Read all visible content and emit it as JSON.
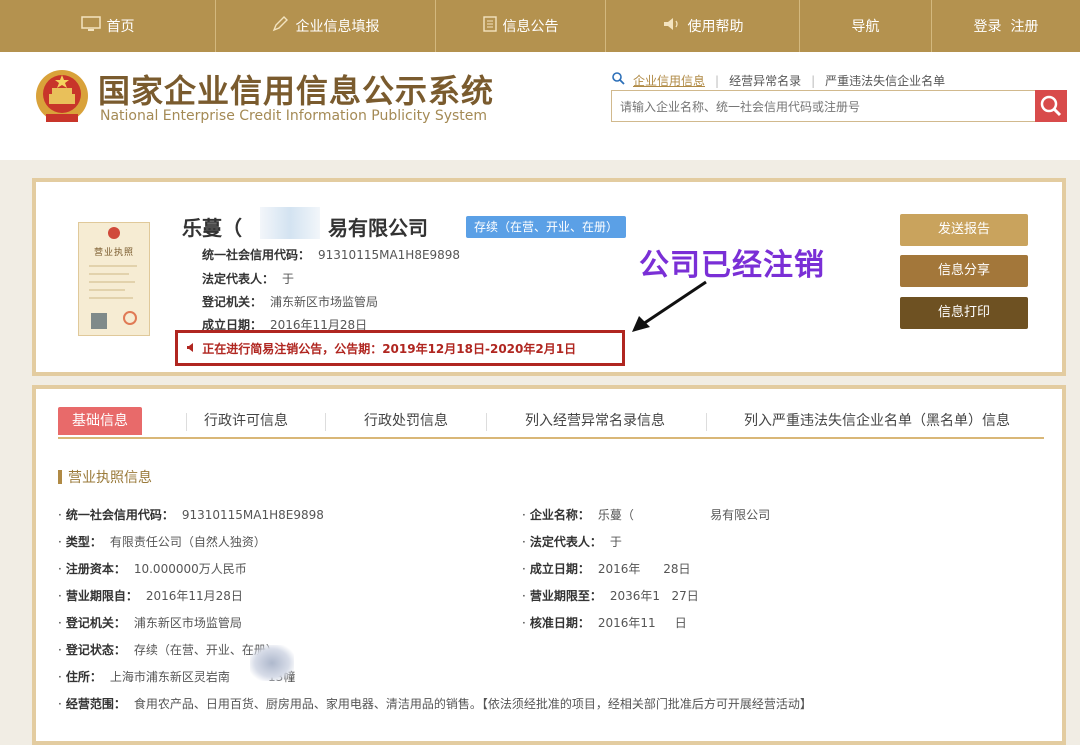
{
  "nav": {
    "items": [
      {
        "label": "首页",
        "icon": "monitor-icon"
      },
      {
        "label": "企业信息填报",
        "icon": "edit-icon"
      },
      {
        "label": "信息公告",
        "icon": "document-icon"
      },
      {
        "label": "使用帮助",
        "icon": "speaker-icon"
      },
      {
        "label": "导航",
        "icon": ""
      },
      {
        "label": "登录  注册",
        "icon": ""
      }
    ]
  },
  "header": {
    "title_cn": "国家企业信用信息公示系统",
    "title_en": "National Enterprise Credit Information Publicity System"
  },
  "search": {
    "links": [
      "企业信用信息",
      "经营异常名录",
      "严重违法失信企业名单"
    ],
    "placeholder": "请输入企业名称、统一社会信用代码或注册号"
  },
  "company": {
    "license_title": "营业执照",
    "name_prefix": "乐蔓（",
    "name_suffix": "易有限公司",
    "status_badge": "存续（在营、开业、在册）",
    "credit_code_label": "统一社会信用代码：",
    "credit_code": "91310115MA1H8E9898",
    "legal_rep_label": "法定代表人：",
    "legal_rep": "于",
    "authority_label": "登记机关：",
    "authority": "浦东新区市场监管局",
    "founded_label": "成立日期：",
    "founded": "2016年11月28日",
    "notice": "正在进行简易注销公告，公告期：2019年12月18日-2020年2月1日",
    "annotation": "公司已经注销"
  },
  "buttons": {
    "send_report": "发送报告",
    "share": "信息分享",
    "print": "信息打印"
  },
  "colors": {
    "nav_bg": "#b4924f",
    "send_btn": "#c9a35d",
    "share_btn": "#a3773a",
    "print_btn": "#6e5122",
    "notice_red": "#b02620",
    "annotation_purple": "#7a2fd6",
    "badge_blue": "#5ba0e6",
    "tab_active": "#e86a6a"
  },
  "tabs": [
    "基础信息",
    "行政许可信息",
    "行政处罚信息",
    "列入经营异常名录信息",
    "列入严重违法失信企业名单（黑名单）信息"
  ],
  "section": {
    "title": "营业执照信息",
    "fields": [
      {
        "label": "统一社会信用代码：",
        "value": "91310115MA1H8E9898"
      },
      {
        "label": "企业名称：",
        "value": "乐蔓（                    易有限公司"
      },
      {
        "label": "类型：",
        "value": "有限责任公司（自然人独资）"
      },
      {
        "label": "法定代表人：",
        "value": "于"
      },
      {
        "label": "注册资本：",
        "value": "10.000000万人民币"
      },
      {
        "label": "成立日期：",
        "value": "2016年      28日"
      },
      {
        "label": "营业期限自：",
        "value": "2016年11月28日"
      },
      {
        "label": "营业期限至：",
        "value": "2036年1   27日"
      },
      {
        "label": "登记机关：",
        "value": "浦东新区市场监管局"
      },
      {
        "label": "核准日期：",
        "value": "2016年11     日"
      },
      {
        "label": "登记状态：",
        "value": "存续（在营、开业、在册）"
      },
      {
        "label": "住所：",
        "value": "上海市浦东新区灵岩南          13幢"
      },
      {
        "label": "经营范围：",
        "value": "食用农产品、日用百货、厨房用品、家用电器、清洁用品的销售。【依法须经批准的项目，经相关部门批准后方可开展经营活动】"
      }
    ]
  }
}
